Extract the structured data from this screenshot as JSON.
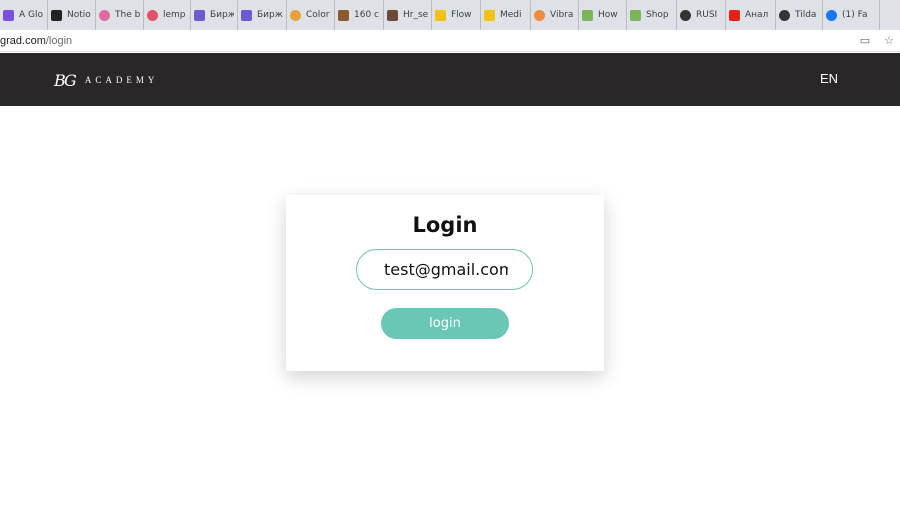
{
  "browser": {
    "tabs": [
      {
        "label": "A Glo",
        "icon": "mail-icon",
        "color": "#7b4fe0"
      },
      {
        "label": "Notio",
        "icon": "notion-icon",
        "color": "#222222"
      },
      {
        "label": "The b",
        "icon": "spiral-icon",
        "color": "#e06aa0"
      },
      {
        "label": "lemp",
        "icon": "spiral-icon",
        "color": "#e0556a"
      },
      {
        "label": "Бирж",
        "icon": "exchange-icon",
        "color": "#6d5ad0"
      },
      {
        "label": "Бирж",
        "icon": "exchange-icon",
        "color": "#6d5ad0"
      },
      {
        "label": "Color",
        "icon": "color-wheel-icon",
        "color": "#e8a13a"
      },
      {
        "label": "160 c",
        "icon": "horse-icon",
        "color": "#8a5a2b"
      },
      {
        "label": "Hr_se",
        "icon": "person-icon",
        "color": "#6b4a3a"
      },
      {
        "label": "Flow",
        "icon": "miro-icon",
        "color": "#f2c21b"
      },
      {
        "label": "Medi",
        "icon": "miro-icon",
        "color": "#f2c21b"
      },
      {
        "label": "Vibra",
        "icon": "dot-icon",
        "color": "#f08a3c"
      },
      {
        "label": "How",
        "icon": "shopify-icon",
        "color": "#7ab55c"
      },
      {
        "label": "Shop",
        "icon": "shopify-icon",
        "color": "#7ab55c"
      },
      {
        "label": "RUSI",
        "icon": "r-icon",
        "color": "#333333"
      },
      {
        "label": "Анал",
        "icon": "youtube-icon",
        "color": "#e62117"
      },
      {
        "label": "Tilda",
        "icon": "tilda-icon",
        "color": "#333333"
      },
      {
        "label": "(1) Fa",
        "icon": "facebook-icon",
        "color": "#1877f2"
      }
    ],
    "url_host": "grad.com",
    "url_path": "/login"
  },
  "header": {
    "logo_mark": "BG",
    "logo_text": "ACADEMY",
    "language": "EN"
  },
  "login": {
    "title": "Login",
    "email_value": "test@gmail.com",
    "button_label": "login"
  },
  "colors": {
    "header_bg": "#2b2627",
    "accent": "#6ac6b5",
    "input_border": "#6cc4b4"
  }
}
